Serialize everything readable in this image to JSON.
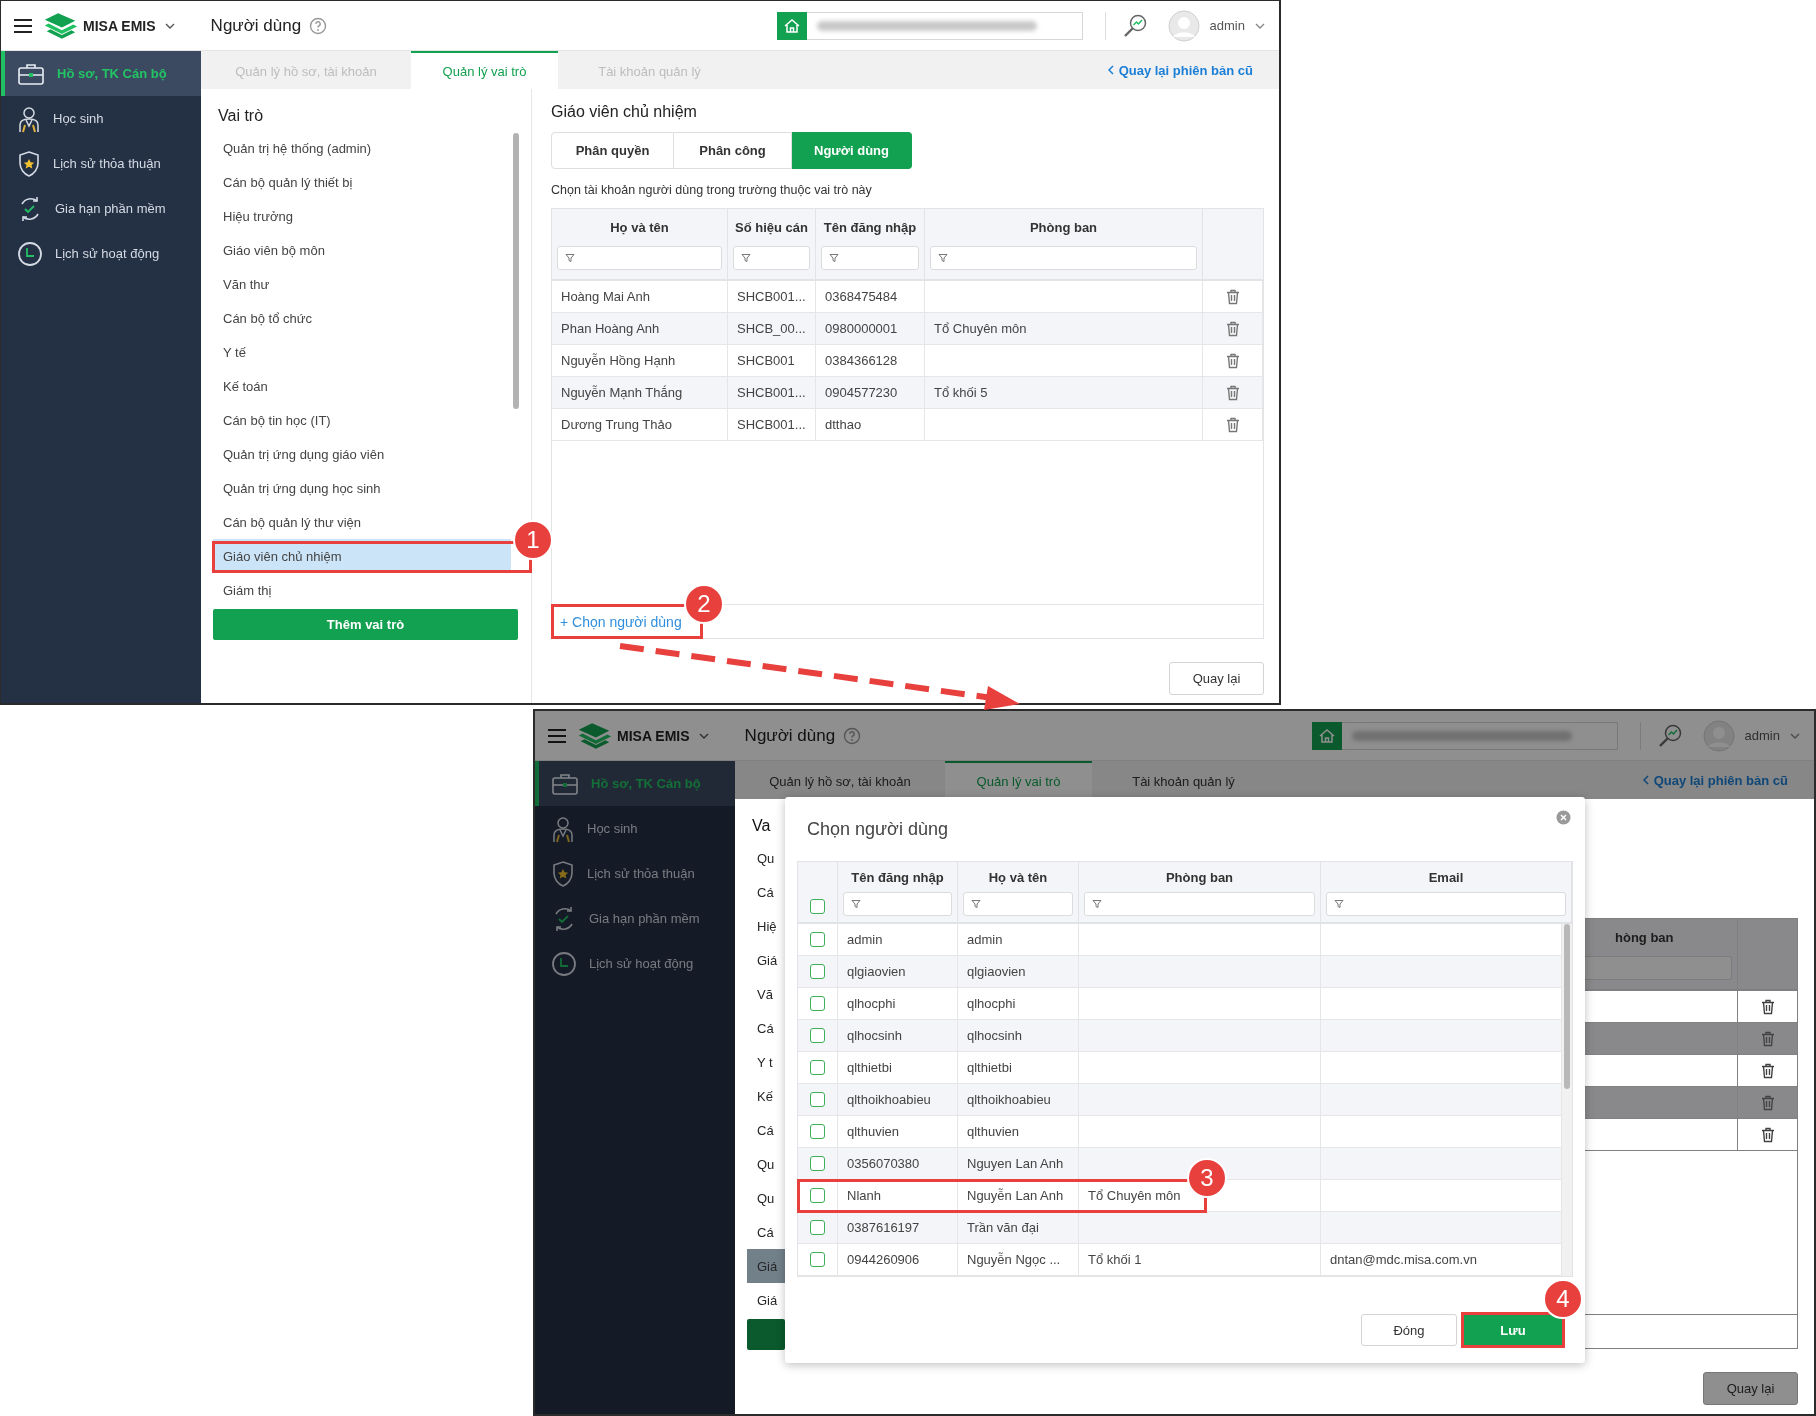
{
  "screens": [
    {
      "header": {
        "app_name": "MISA EMIS",
        "page_title": "Người dùng",
        "user": "admin"
      },
      "sidebar": [
        {
          "label": "Hồ sơ, TK Cán bộ",
          "selected": true
        },
        {
          "label": "Học sinh",
          "selected": false
        },
        {
          "label": "Lịch sử thỏa thuận",
          "selected": false
        },
        {
          "label": "Gia hạn phần mềm",
          "selected": false
        },
        {
          "label": "Lịch sử hoạt động",
          "selected": false
        }
      ],
      "tabs": [
        {
          "label": "Quản lý hồ sơ, tài khoản",
          "selected": false
        },
        {
          "label": "Quản lý vai trò",
          "selected": true
        },
        {
          "label": "Tài khoản quản lý",
          "selected": false
        }
      ],
      "back_link": "Quay lại phiên bản cũ",
      "roles": {
        "title": "Vai trò",
        "items": [
          {
            "label": "Quản trị hệ thống (admin)",
            "selected": false
          },
          {
            "label": "Cán bộ quản lý thiết bị",
            "selected": false
          },
          {
            "label": "Hiệu trưởng",
            "selected": false
          },
          {
            "label": "Giáo viên bộ môn",
            "selected": false
          },
          {
            "label": "Văn thư",
            "selected": false
          },
          {
            "label": "Cán bộ tổ chức",
            "selected": false
          },
          {
            "label": "Y tế",
            "selected": false
          },
          {
            "label": "Kế toán",
            "selected": false
          },
          {
            "label": "Cán bộ tin học (IT)",
            "selected": false
          },
          {
            "label": "Quản trị ứng dụng giáo viên",
            "selected": false
          },
          {
            "label": "Quản trị ứng dụng học sinh",
            "selected": false
          },
          {
            "label": "Cán bộ quản lý thư viện",
            "selected": false
          },
          {
            "label": "Giáo viên chủ nhiệm",
            "selected": true
          },
          {
            "label": "Giám thị",
            "selected": false
          }
        ],
        "add_button": "Thêm vai trò"
      },
      "detail": {
        "title": "Giáo viên chủ nhiệm",
        "segments": [
          {
            "label": "Phân quyền",
            "selected": false
          },
          {
            "label": "Phân công",
            "selected": false
          },
          {
            "label": "Người dùng",
            "selected": true
          }
        ],
        "description": "Chọn tài khoản người dùng trong trường thuộc vai trò này",
        "table": {
          "columns": [
            "Họ và tên",
            "Số hiệu cán",
            "Tên đăng nhập",
            "Phòng ban"
          ],
          "rows": [
            {
              "name": "Hoàng Mai Anh",
              "code": "SHCB001...",
              "login": "0368475484"
            },
            {
              "name": "Phan Hoàng Anh",
              "code": "SHCB_00...",
              "login": "0980000001",
              "department": "Tổ Chuyên môn"
            },
            {
              "name": "Nguyễn Hồng Hạnh",
              "code": "SHCB001",
              "login": "0384366128"
            },
            {
              "name": "Nguyễn Mạnh Thắng",
              "code": "SHCB001...",
              "login": "0904577230",
              "department": "Tổ khối 5"
            },
            {
              "name": "Dương Trung Thảo",
              "code": "SHCB001...",
              "login": "dtthao"
            }
          ]
        },
        "add_user": "+ Chọn người dùng"
      },
      "back_button": "Quay lại"
    },
    {
      "header": {
        "app_name": "MISA EMIS",
        "page_title": "Người dùng",
        "user": "admin"
      },
      "sidebar": [
        {
          "label": "Hồ sơ, TK Cán bộ",
          "selected": true
        },
        {
          "label": "Học sinh",
          "selected": false
        },
        {
          "label": "Lịch sử thỏa thuận",
          "selected": false
        },
        {
          "label": "Gia hạn phần mềm",
          "selected": false
        },
        {
          "label": "Lịch sử hoạt động",
          "selected": false
        }
      ],
      "tabs": [
        {
          "label": "Quản lý hồ sơ, tài khoản",
          "selected": false
        },
        {
          "label": "Quản lý vai trò",
          "selected": true
        },
        {
          "label": "Tài khoản quản lý",
          "selected": false
        }
      ],
      "back_link": "Quay lại phiên bản cũ",
      "roles": {
        "title": "Va",
        "items": [
          {
            "label": "Qu",
            "selected": false
          },
          {
            "label": "Cá",
            "selected": false
          },
          {
            "label": "Hiệ",
            "selected": false
          },
          {
            "label": "Giá",
            "selected": false
          },
          {
            "label": "Vă",
            "selected": false
          },
          {
            "label": "Cá",
            "selected": false
          },
          {
            "label": "Y t",
            "selected": false
          },
          {
            "label": "Kế",
            "selected": false
          },
          {
            "label": "Cá",
            "selected": false
          },
          {
            "label": "Qu",
            "selected": false
          },
          {
            "label": "Qu",
            "selected": false
          },
          {
            "label": "Cá",
            "selected": false
          },
          {
            "label": "Giá",
            "selected": true
          },
          {
            "label": "Giá",
            "selected": false
          }
        ]
      },
      "background_table": {
        "column": "hòng ban"
      },
      "back_button": "Quay lại",
      "dialog": {
        "title": "Chọn người dùng",
        "columns": [
          "Tên đăng nhập",
          "Họ và tên",
          "Phòng ban",
          "Email"
        ],
        "select_all_checked": false,
        "rows": [
          {
            "login": "admin",
            "name": "admin",
            "checked": false
          },
          {
            "login": "qlgiaovien",
            "name": "qlgiaovien",
            "checked": false
          },
          {
            "login": "qlhocphi",
            "name": "qlhocphi",
            "checked": false
          },
          {
            "login": "qlhocsinh",
            "name": "qlhocsinh",
            "checked": false
          },
          {
            "login": "qlthietbi",
            "name": "qlthietbi",
            "checked": false
          },
          {
            "login": "qlthoikhoabieu",
            "name": "qlthoikhoabieu",
            "checked": false
          },
          {
            "login": "qlthuvien",
            "name": "qlthuvien",
            "checked": false
          },
          {
            "login": "0356070380",
            "name": "Nguyen Lan Anh",
            "checked": false
          },
          {
            "login": "Nlanh",
            "name": "Nguyễn Lan Anh",
            "department": "Tổ Chuyên môn",
            "checked": false
          },
          {
            "login": "0387616197",
            "name": "Trần văn đại",
            "checked": false
          },
          {
            "login": "0944260906",
            "name": "Nguyễn Ngọc ...",
            "department": "Tổ khối 1",
            "email": "dntan@mdc.misa.com.vn",
            "checked": false
          }
        ],
        "buttons": [
          {
            "label": "Đóng",
            "kind": "secondary"
          },
          {
            "label": "Lưu",
            "kind": "primary"
          }
        ]
      }
    }
  ],
  "annotations": [
    {
      "label": "1"
    },
    {
      "label": "2"
    },
    {
      "label": "3"
    },
    {
      "label": "4"
    }
  ]
}
